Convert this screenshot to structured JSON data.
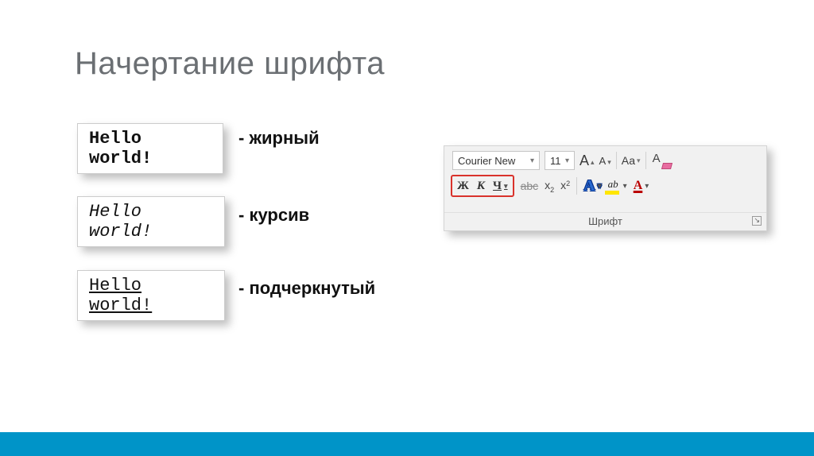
{
  "title": "Начертание шрифта",
  "samples": {
    "bold": "Hello world!",
    "italic": "Hello world!",
    "underline": "Hello world!"
  },
  "labels": {
    "bold": "- жирный",
    "italic": "- курсив",
    "underline": "- подчеркнутый"
  },
  "ribbon": {
    "font_name": "Courier New",
    "font_size": "11",
    "grow_font": "А",
    "shrink_font": "А",
    "change_case": "Аа",
    "clear_format_A": "А",
    "bold": "Ж",
    "italic": "К",
    "underline": "Ч",
    "strike": "abc",
    "sub_x": "x",
    "sub_2": "2",
    "sup_x": "x",
    "sup_2": "2",
    "effects": "A",
    "highlight_abc": "ab",
    "font_color_A": "А",
    "group_label": "Шрифт"
  }
}
